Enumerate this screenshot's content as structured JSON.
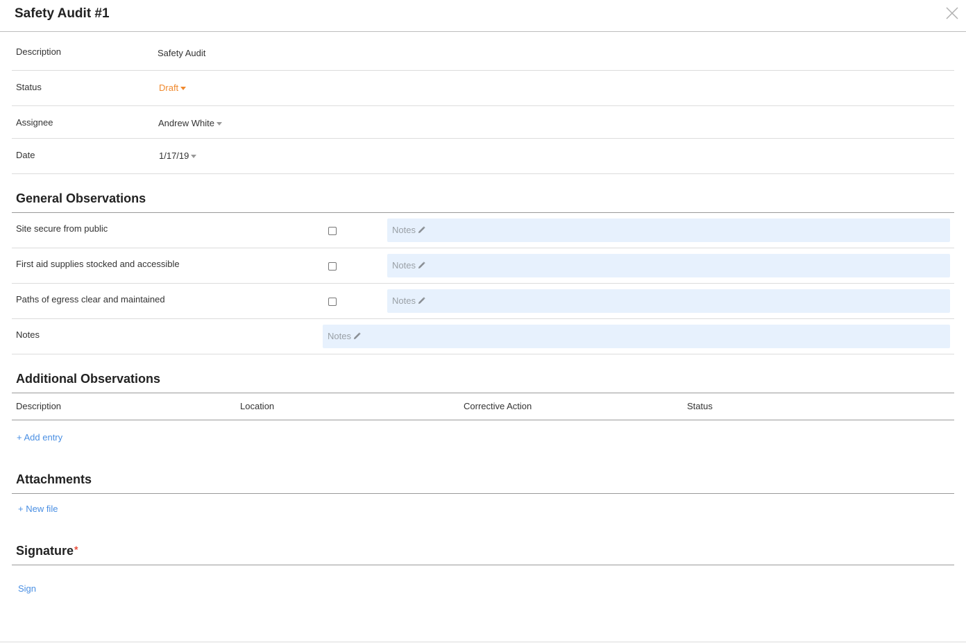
{
  "header": {
    "title": "Safety Audit #1"
  },
  "details": {
    "description_label": "Description",
    "description_value": "Safety Audit",
    "status_label": "Status",
    "status_value": "Draft",
    "assignee_label": "Assignee",
    "assignee_value": "Andrew White",
    "date_label": "Date",
    "date_value": "1/17/19"
  },
  "general": {
    "title": "General Observations",
    "items": [
      {
        "label": "Site secure from public",
        "notes_placeholder": "Notes"
      },
      {
        "label": "First aid supplies stocked and accessible",
        "notes_placeholder": "Notes"
      },
      {
        "label": "Paths of egress clear and maintained",
        "notes_placeholder": "Notes"
      }
    ],
    "notes_label": "Notes",
    "notes_placeholder": "Notes"
  },
  "additional": {
    "title": "Additional Observations",
    "columns": [
      "Description",
      "Location",
      "Corrective Action",
      "Status"
    ],
    "add_entry": "+ Add entry"
  },
  "attachments": {
    "title": "Attachments",
    "new_file": "+ New file"
  },
  "signature": {
    "title": "Signature",
    "required_mark": "*",
    "sign": "Sign"
  },
  "colors": {
    "accent_link": "#4a8fe3",
    "status_draft": "#f0892d",
    "notes_bg": "#e7f1fd",
    "required": "#e94e3c"
  }
}
